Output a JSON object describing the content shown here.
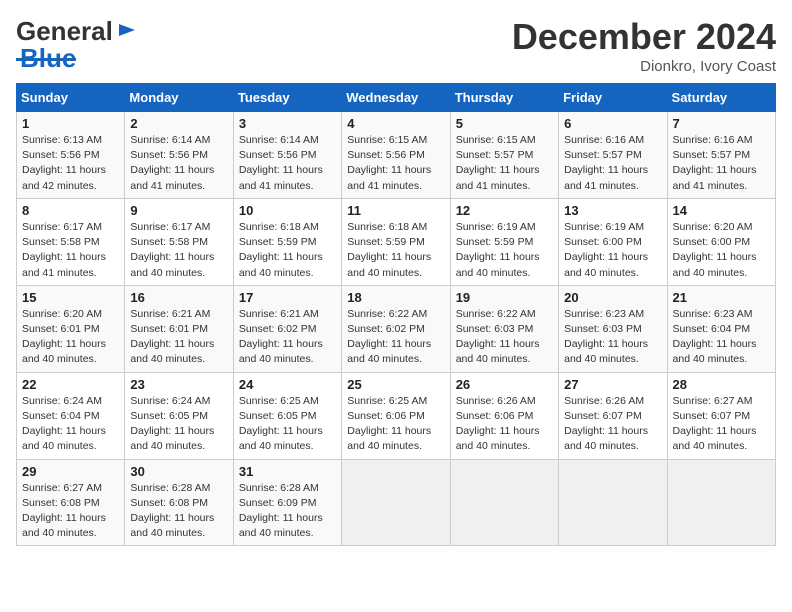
{
  "header": {
    "logo_line1": "General",
    "logo_line2": "Blue",
    "month_title": "December 2024",
    "location": "Dionkro, Ivory Coast"
  },
  "days_of_week": [
    "Sunday",
    "Monday",
    "Tuesday",
    "Wednesday",
    "Thursday",
    "Friday",
    "Saturday"
  ],
  "weeks": [
    [
      {
        "day": "1",
        "sunrise": "6:13 AM",
        "sunset": "5:56 PM",
        "daylight": "11 hours and 42 minutes."
      },
      {
        "day": "2",
        "sunrise": "6:14 AM",
        "sunset": "5:56 PM",
        "daylight": "11 hours and 41 minutes."
      },
      {
        "day": "3",
        "sunrise": "6:14 AM",
        "sunset": "5:56 PM",
        "daylight": "11 hours and 41 minutes."
      },
      {
        "day": "4",
        "sunrise": "6:15 AM",
        "sunset": "5:56 PM",
        "daylight": "11 hours and 41 minutes."
      },
      {
        "day": "5",
        "sunrise": "6:15 AM",
        "sunset": "5:57 PM",
        "daylight": "11 hours and 41 minutes."
      },
      {
        "day": "6",
        "sunrise": "6:16 AM",
        "sunset": "5:57 PM",
        "daylight": "11 hours and 41 minutes."
      },
      {
        "day": "7",
        "sunrise": "6:16 AM",
        "sunset": "5:57 PM",
        "daylight": "11 hours and 41 minutes."
      }
    ],
    [
      {
        "day": "8",
        "sunrise": "6:17 AM",
        "sunset": "5:58 PM",
        "daylight": "11 hours and 41 minutes."
      },
      {
        "day": "9",
        "sunrise": "6:17 AM",
        "sunset": "5:58 PM",
        "daylight": "11 hours and 40 minutes."
      },
      {
        "day": "10",
        "sunrise": "6:18 AM",
        "sunset": "5:59 PM",
        "daylight": "11 hours and 40 minutes."
      },
      {
        "day": "11",
        "sunrise": "6:18 AM",
        "sunset": "5:59 PM",
        "daylight": "11 hours and 40 minutes."
      },
      {
        "day": "12",
        "sunrise": "6:19 AM",
        "sunset": "5:59 PM",
        "daylight": "11 hours and 40 minutes."
      },
      {
        "day": "13",
        "sunrise": "6:19 AM",
        "sunset": "6:00 PM",
        "daylight": "11 hours and 40 minutes."
      },
      {
        "day": "14",
        "sunrise": "6:20 AM",
        "sunset": "6:00 PM",
        "daylight": "11 hours and 40 minutes."
      }
    ],
    [
      {
        "day": "15",
        "sunrise": "6:20 AM",
        "sunset": "6:01 PM",
        "daylight": "11 hours and 40 minutes."
      },
      {
        "day": "16",
        "sunrise": "6:21 AM",
        "sunset": "6:01 PM",
        "daylight": "11 hours and 40 minutes."
      },
      {
        "day": "17",
        "sunrise": "6:21 AM",
        "sunset": "6:02 PM",
        "daylight": "11 hours and 40 minutes."
      },
      {
        "day": "18",
        "sunrise": "6:22 AM",
        "sunset": "6:02 PM",
        "daylight": "11 hours and 40 minutes."
      },
      {
        "day": "19",
        "sunrise": "6:22 AM",
        "sunset": "6:03 PM",
        "daylight": "11 hours and 40 minutes."
      },
      {
        "day": "20",
        "sunrise": "6:23 AM",
        "sunset": "6:03 PM",
        "daylight": "11 hours and 40 minutes."
      },
      {
        "day": "21",
        "sunrise": "6:23 AM",
        "sunset": "6:04 PM",
        "daylight": "11 hours and 40 minutes."
      }
    ],
    [
      {
        "day": "22",
        "sunrise": "6:24 AM",
        "sunset": "6:04 PM",
        "daylight": "11 hours and 40 minutes."
      },
      {
        "day": "23",
        "sunrise": "6:24 AM",
        "sunset": "6:05 PM",
        "daylight": "11 hours and 40 minutes."
      },
      {
        "day": "24",
        "sunrise": "6:25 AM",
        "sunset": "6:05 PM",
        "daylight": "11 hours and 40 minutes."
      },
      {
        "day": "25",
        "sunrise": "6:25 AM",
        "sunset": "6:06 PM",
        "daylight": "11 hours and 40 minutes."
      },
      {
        "day": "26",
        "sunrise": "6:26 AM",
        "sunset": "6:06 PM",
        "daylight": "11 hours and 40 minutes."
      },
      {
        "day": "27",
        "sunrise": "6:26 AM",
        "sunset": "6:07 PM",
        "daylight": "11 hours and 40 minutes."
      },
      {
        "day": "28",
        "sunrise": "6:27 AM",
        "sunset": "6:07 PM",
        "daylight": "11 hours and 40 minutes."
      }
    ],
    [
      {
        "day": "29",
        "sunrise": "6:27 AM",
        "sunset": "6:08 PM",
        "daylight": "11 hours and 40 minutes."
      },
      {
        "day": "30",
        "sunrise": "6:28 AM",
        "sunset": "6:08 PM",
        "daylight": "11 hours and 40 minutes."
      },
      {
        "day": "31",
        "sunrise": "6:28 AM",
        "sunset": "6:09 PM",
        "daylight": "11 hours and 40 minutes."
      },
      null,
      null,
      null,
      null
    ]
  ]
}
